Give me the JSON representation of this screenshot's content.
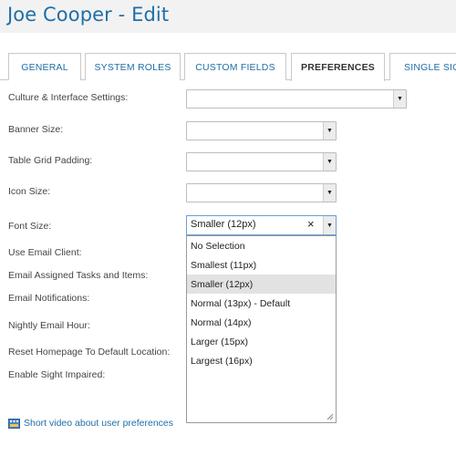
{
  "header": {
    "title": "Joe Cooper - Edit"
  },
  "tabs": [
    {
      "label": "GENERAL",
      "active": false
    },
    {
      "label": "SYSTEM ROLES",
      "active": false
    },
    {
      "label": "CUSTOM FIELDS",
      "active": false
    },
    {
      "label": "PREFERENCES",
      "active": true
    },
    {
      "label": "SINGLE SIGI",
      "active": false
    }
  ],
  "form": {
    "culture": {
      "label": "Culture & Interface Settings:",
      "value": ""
    },
    "banner": {
      "label": "Banner Size:",
      "value": ""
    },
    "grid_padding": {
      "label": "Table Grid Padding:",
      "value": ""
    },
    "icon_size": {
      "label": "Icon Size:",
      "value": ""
    },
    "font_size": {
      "label": "Font Size:",
      "value": "Smaller (12px)",
      "clear_glyph": "×"
    },
    "email_client": {
      "label": "Use Email Client:"
    },
    "email_assigned": {
      "label": "Email Assigned Tasks and Items:"
    },
    "email_notifications": {
      "label": "Email Notifications:"
    },
    "nightly_hour": {
      "label": "Nightly Email Hour:"
    },
    "reset_homepage": {
      "label": "Reset Homepage To Default Location:"
    },
    "sight_impaired": {
      "label": "Enable Sight Impaired:"
    }
  },
  "dropdown": {
    "options": [
      "No Selection",
      "Smallest (11px)",
      "Smaller (12px)",
      "Normal (13px) - Default",
      "Normal (14px)",
      "Larger (15px)",
      "Largest (16px)"
    ],
    "selected_index": 2
  },
  "help": {
    "link_text": "Short video about user preferences",
    "icon": "film-icon"
  },
  "colors": {
    "accent": "#1f6fa8",
    "selected_bg": "#e2e2e2",
    "focus_border": "#6a9fd4"
  }
}
